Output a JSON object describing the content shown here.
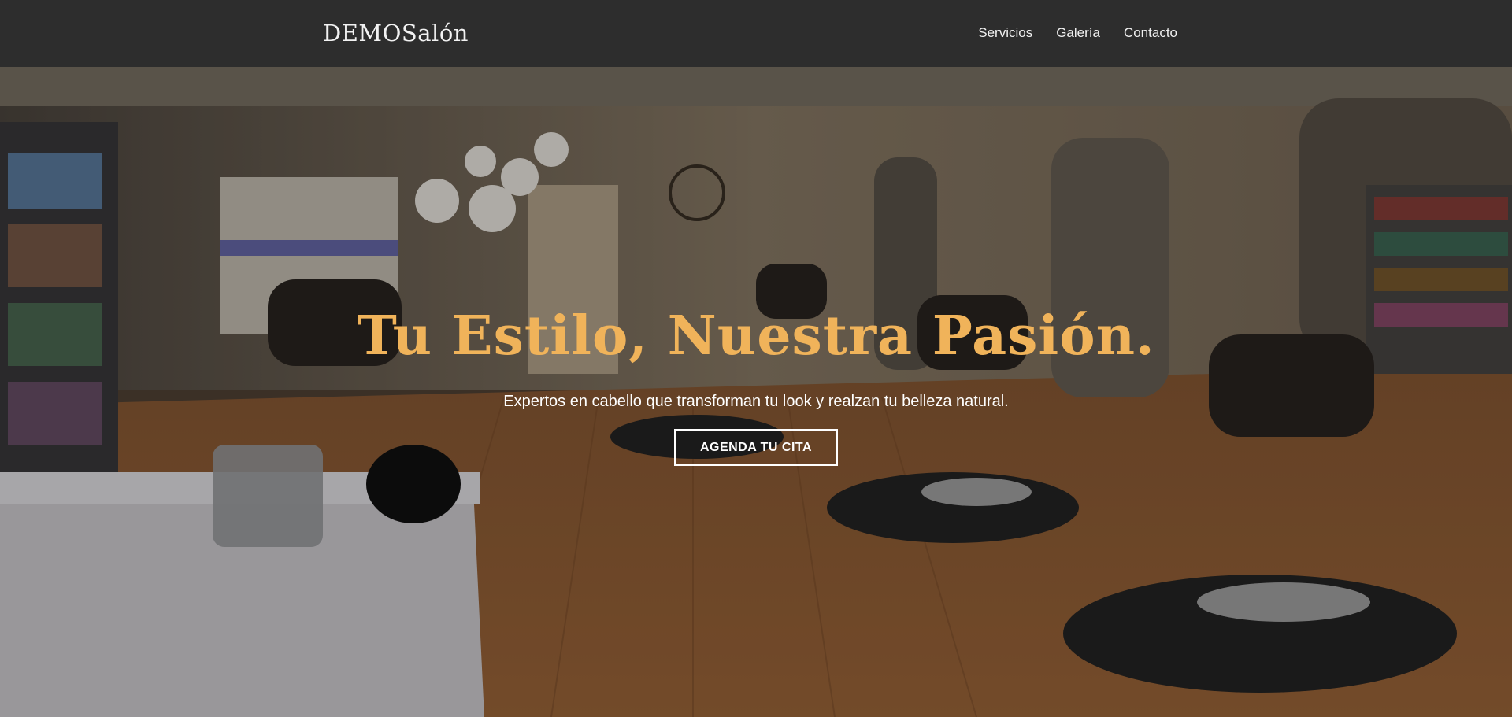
{
  "header": {
    "brand": "DEMOSalón",
    "nav": [
      {
        "label": "Servicios"
      },
      {
        "label": "Galería"
      },
      {
        "label": "Contacto"
      }
    ]
  },
  "hero": {
    "title": "Tu Estilo, Nuestra Pasión.",
    "subtitle": "Expertos en cabello que transforman tu look y realzan tu belleza natural.",
    "cta_label": "AGENDA TU CITA",
    "background_image": "salon-interior-photo"
  },
  "colors": {
    "header_bg": "#2d2d2d",
    "accent": "#f0b35a",
    "text_light": "#ffffff"
  }
}
